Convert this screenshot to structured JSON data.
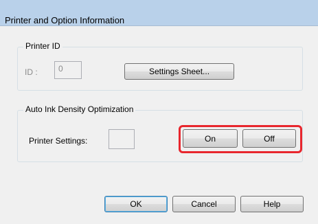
{
  "window": {
    "title": "Printer and Option Information"
  },
  "printer_id": {
    "legend": "Printer ID",
    "id_label": "ID :",
    "id_value": "0",
    "settings_sheet_button": "Settings Sheet..."
  },
  "auto_ink": {
    "legend": "Auto Ink Density Optimization",
    "printer_settings_label": "Printer Settings:",
    "printer_settings_value": "",
    "on_button": "On",
    "off_button": "Off"
  },
  "footer": {
    "ok_button": "OK",
    "cancel_button": "Cancel",
    "help_button": "Help"
  },
  "colors": {
    "titlebar": "#b9d1ea",
    "dialog_bg": "#f0f0f0",
    "highlight": "#e8262d",
    "default_button_border": "#3c7fb1"
  }
}
